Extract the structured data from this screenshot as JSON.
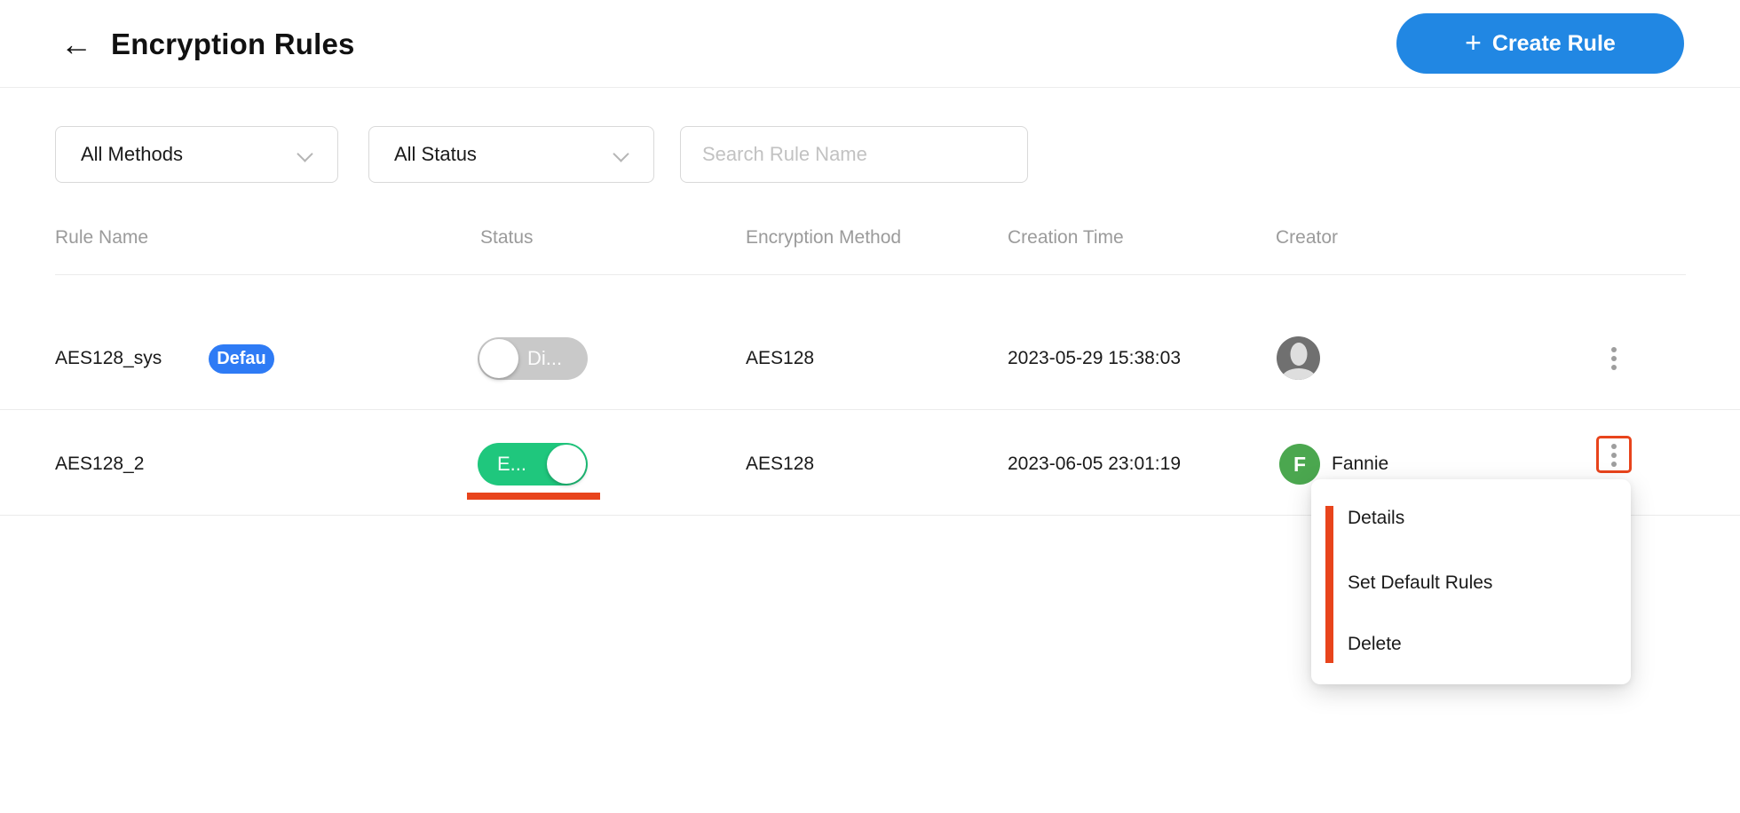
{
  "header": {
    "title": "Encryption Rules",
    "create_button": {
      "label": "Create Rule"
    }
  },
  "icons": {
    "back": "←",
    "plus": "+"
  },
  "filters": {
    "method": {
      "value": "All Methods"
    },
    "status": {
      "value": "All Status"
    },
    "search": {
      "placeholder": "Search Rule Name"
    }
  },
  "table": {
    "columns": [
      "Rule Name",
      "Status",
      "Encryption Method",
      "Creation Time",
      "Creator"
    ],
    "rows": [
      {
        "name": "AES128_sys",
        "badge": "Defau",
        "status_label": "Di...",
        "status_on": false,
        "method": "AES128",
        "created": "2023-05-29 15:38:03"
      },
      {
        "name": "AES128_2",
        "status_label": "E...",
        "status_on": true,
        "method": "AES128",
        "created": "2023-06-05 23:01:19",
        "creator_initial": "F",
        "creator_name": "Fannie"
      }
    ]
  },
  "menu": {
    "items": [
      "Details",
      "Set Default Rules",
      "Delete"
    ]
  },
  "colors": {
    "primary_blue": "#2187E3",
    "badge_blue": "#2E7BF5",
    "toggle_on_green": "#1FC77D",
    "toggle_off_gray": "#c9c9c9",
    "annotation_orange": "#E8441C",
    "avatar_green": "#4BA74F",
    "header_text_gray": "#9b9b9b",
    "divider_gray": "#ebebeb"
  }
}
